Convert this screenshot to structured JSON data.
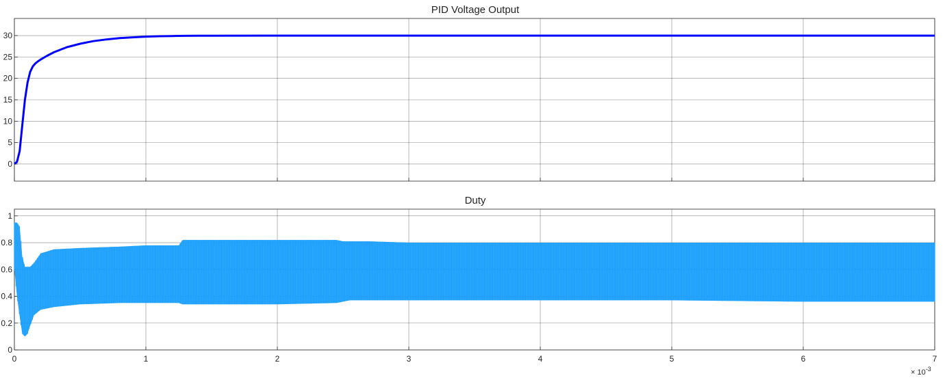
{
  "chart_data": [
    {
      "type": "line",
      "title": "PID Voltage Output",
      "xlabel": "",
      "ylabel": "",
      "xlim": [
        0,
        0.007
      ],
      "ylim": [
        -4,
        34
      ],
      "yticks": [
        0,
        5,
        10,
        15,
        20,
        25,
        30
      ],
      "grid": true,
      "series": [
        {
          "color": "#0000ff",
          "x": [
            0,
            2e-05,
            4e-05,
            6e-05,
            8e-05,
            0.0001,
            0.00012,
            0.00014,
            0.00016,
            0.00018,
            0.0002,
            0.00025,
            0.0003,
            0.0004,
            0.0005,
            0.0006,
            0.0007,
            0.0008,
            0.0009,
            0.001,
            0.0011,
            0.0012,
            0.0013,
            0.0014,
            0.0015,
            0.002,
            0.003,
            0.004,
            0.005,
            0.006,
            0.007
          ],
          "y": [
            0,
            0.5,
            3,
            9,
            15,
            19,
            21.5,
            22.8,
            23.5,
            24,
            24.4,
            25.3,
            26.1,
            27.3,
            28.1,
            28.7,
            29.1,
            29.4,
            29.6,
            29.75,
            29.85,
            29.9,
            29.95,
            29.97,
            29.98,
            30,
            30,
            30,
            30,
            30,
            30
          ]
        }
      ]
    },
    {
      "type": "area",
      "title": "Duty",
      "xlabel": "",
      "ylabel": "",
      "xlim": [
        0,
        0.007
      ],
      "ylim": [
        0,
        1.05
      ],
      "yticks": [
        0,
        0.2,
        0.4,
        0.6,
        0.8,
        1
      ],
      "grid": true,
      "series": [
        {
          "color": "#1a9fff",
          "name_hidden": true,
          "x": [
            0,
            2e-05,
            4e-05,
            6e-05,
            8e-05,
            0.0001,
            0.00012,
            0.00015,
            0.0002,
            0.0003,
            0.0005,
            0.0008,
            0.001,
            0.00125,
            0.00128,
            0.0015,
            0.002,
            0.00245,
            0.0025,
            0.00255,
            0.0027,
            0.003,
            0.004,
            0.005,
            0.006,
            0.007
          ],
          "upper": [
            0.95,
            0.95,
            0.92,
            0.7,
            0.62,
            0.62,
            0.62,
            0.65,
            0.72,
            0.75,
            0.76,
            0.77,
            0.78,
            0.78,
            0.82,
            0.82,
            0.82,
            0.82,
            0.81,
            0.81,
            0.81,
            0.8,
            0.8,
            0.8,
            0.8,
            0.8
          ],
          "lower": [
            0.6,
            0.4,
            0.25,
            0.12,
            0.1,
            0.12,
            0.18,
            0.26,
            0.3,
            0.32,
            0.34,
            0.35,
            0.35,
            0.35,
            0.34,
            0.34,
            0.34,
            0.35,
            0.36,
            0.37,
            0.37,
            0.37,
            0.37,
            0.37,
            0.36,
            0.36
          ]
        }
      ]
    }
  ],
  "shared_x": {
    "ticks": [
      0,
      0.001,
      0.002,
      0.003,
      0.004,
      0.005,
      0.006,
      0.007
    ],
    "tick_labels": [
      "0",
      "1",
      "2",
      "3",
      "4",
      "5",
      "6",
      "7"
    ],
    "exponent_label": "× 10",
    "exponent_power": "-3"
  }
}
